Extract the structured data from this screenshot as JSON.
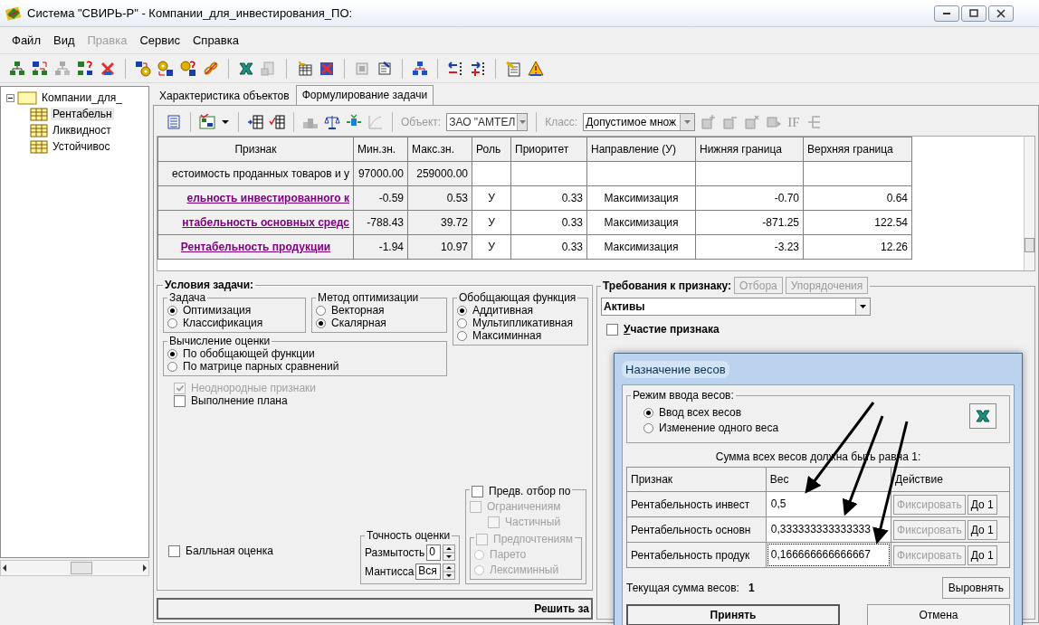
{
  "window": {
    "title": "Система \"СВИРЬ-Р\" - Компании_для_инвестирования_ПО:"
  },
  "menu": [
    {
      "label": "Файл",
      "disabled": false
    },
    {
      "label": "Вид",
      "disabled": false
    },
    {
      "label": "Правка",
      "disabled": true
    },
    {
      "label": "Сервис",
      "disabled": false
    },
    {
      "label": "Справка",
      "disabled": false
    }
  ],
  "tree": {
    "label": "Компании_для_",
    "expanded": true,
    "children": [
      {
        "label": "Рентабельн",
        "selected": true
      },
      {
        "label": "Ликвидност",
        "selected": false
      },
      {
        "label": "Устойчивос",
        "selected": false
      }
    ]
  },
  "tabs": [
    {
      "label": "Характеристика объектов",
      "selected": false
    },
    {
      "label": "Формулирование задачи",
      "selected": true
    }
  ],
  "task_toolbar": {
    "object_label": "Объект:",
    "object_value": "ЗАО \"АМТЕЛ",
    "class_label": "Класс:",
    "class_value": "Допустимое множ",
    "if_label": "IF"
  },
  "grid": {
    "columns": [
      "Признак",
      "Мин.зн.",
      "Макс.зн.",
      "Роль",
      "Приоритет",
      "Направление (У)",
      "Нижняя граница",
      "Верхняя граница"
    ],
    "rows": [
      {
        "kind": "group",
        "name": "естоимость проданных товаров и у",
        "min": "97000.00",
        "max": "259000.00"
      },
      {
        "kind": "clipped_criterion",
        "name": "ельность инвестированного к",
        "min": "-0.59",
        "max": "0.53",
        "role": "У",
        "priority": "0.33",
        "direction": "Максимизация",
        "lower": "-0.70",
        "upper": "0.64"
      },
      {
        "kind": "clipped_criterion",
        "name": "нтабельность основных средс",
        "min": "-788.43",
        "max": "39.72",
        "role": "У",
        "priority": "0.33",
        "direction": "Максимизация",
        "lower": "-871.25",
        "upper": "122.54"
      },
      {
        "kind": "criterion",
        "name": "Рентабельность продукции",
        "min": "-1.94",
        "max": "10.97",
        "role": "У",
        "priority": "0.33",
        "direction": "Максимизация",
        "lower": "-3.23",
        "upper": "12.26"
      }
    ]
  },
  "conditions": {
    "title": "Условия задачи:",
    "groups": [
      {
        "title": "Задача",
        "options": [
          {
            "label": "Оптимизация",
            "selected": true
          },
          {
            "label": "Классификация",
            "selected": false
          }
        ]
      },
      {
        "title": "Метод оптимизации",
        "options": [
          {
            "label": "Векторная",
            "selected": false
          },
          {
            "label": "Скалярная",
            "selected": true
          }
        ]
      },
      {
        "title": "Обобщающая функция",
        "options": [
          {
            "label": "Аддитивная",
            "selected": true
          },
          {
            "label": "Мультипликативная",
            "selected": false
          },
          {
            "label": "Максиминная",
            "selected": false
          }
        ]
      },
      {
        "title": "Вычисление оценки",
        "options": [
          {
            "label": "По обобщающей функции",
            "selected": true
          },
          {
            "label": "По матрице парных сравнений",
            "selected": false
          }
        ]
      }
    ],
    "checkboxes": [
      {
        "label": "Неоднородные признаки",
        "checked": true,
        "disabled": true
      },
      {
        "label": "Выполнение плана",
        "checked": false,
        "disabled": false
      }
    ],
    "score": {
      "label": "Балльная оценка",
      "checked": false
    },
    "precision": {
      "title": "Точность оценки",
      "fields": [
        {
          "label": "Размытость",
          "value": "0"
        },
        {
          "label": "Мантисса",
          "value": "Вся"
        }
      ]
    },
    "preselect": {
      "label": "Предв. отбор по",
      "checked": false,
      "items": [
        {
          "label": "Ограничениям",
          "checked": false,
          "disabled": true
        },
        {
          "label": "Частичный",
          "checked": false,
          "disabled": true
        }
      ],
      "preferences": {
        "label": "Предпочтениям",
        "checked": false,
        "disabled": true,
        "options": [
          {
            "label": "Парето",
            "selected": false,
            "disabled": true
          },
          {
            "label": "Лексиминный",
            "selected": false,
            "disabled": true
          }
        ]
      }
    }
  },
  "solve_button": "Решить за",
  "requirements": {
    "title": "Требования к признаку:",
    "buttons": [
      {
        "label": "Отбора",
        "disabled": true
      },
      {
        "label": "Упорядочения",
        "disabled": true
      }
    ],
    "attribute": "Активы",
    "participation": {
      "label": "Участие признака",
      "checked": false
    }
  },
  "dialog": {
    "title": "Назначение весов",
    "mode": {
      "title": "Режим ввода весов:",
      "options": [
        {
          "label": "Ввод всех весов",
          "selected": true
        },
        {
          "label": "Изменение одного веса",
          "selected": false
        }
      ]
    },
    "note": "Сумма всех весов должна быть равна 1:",
    "columns": [
      "Признак",
      "Вес",
      "Действие"
    ],
    "rows": [
      {
        "name": "Рентабельность инвест",
        "weight": "0,5",
        "fix": {
          "label": "Фиксировать",
          "disabled": true
        },
        "to_one": "До 1",
        "focused": false
      },
      {
        "name": "Рентабельность основн",
        "weight": "0,333333333333333",
        "fix": {
          "label": "Фиксировать",
          "disabled": true
        },
        "to_one": "До 1",
        "focused": false
      },
      {
        "name": "Рентабельность продук",
        "weight": "0,166666666666667",
        "fix": {
          "label": "Фиксировать",
          "disabled": true
        },
        "to_one": "До 1",
        "focused": true
      }
    ],
    "sum_label": "Текущая сумма весов:",
    "sum_value": "1",
    "equalize_button": "Выровнять",
    "accept_button": "Принять",
    "cancel_button": "Отмена"
  }
}
